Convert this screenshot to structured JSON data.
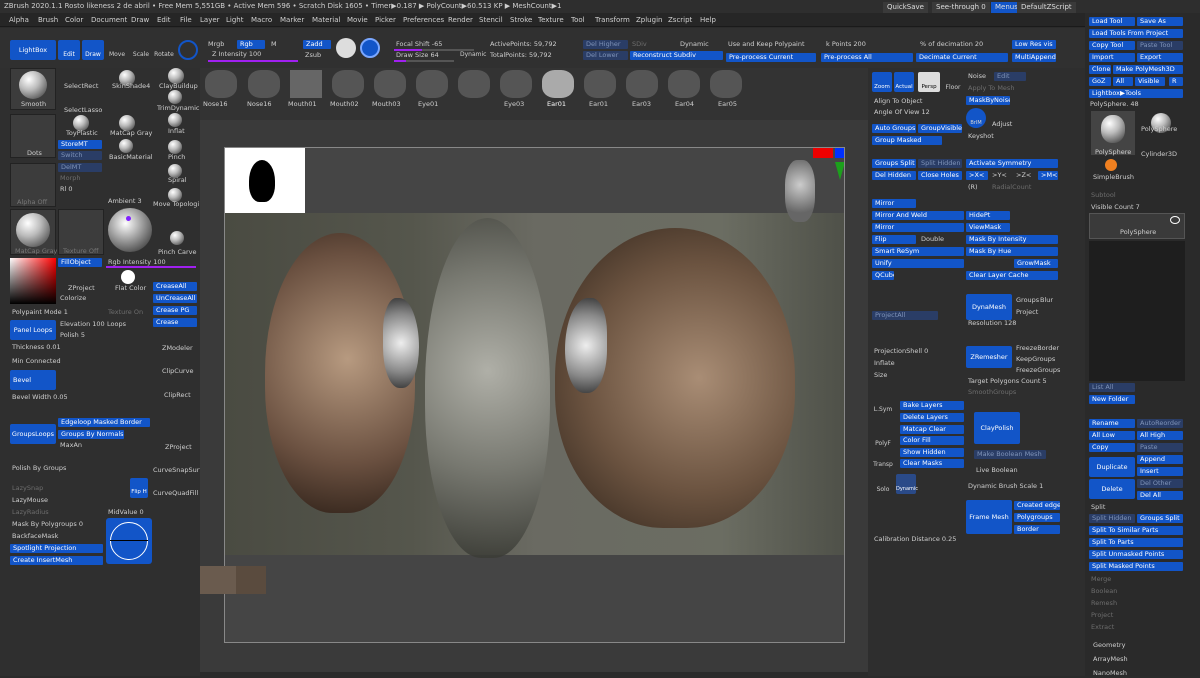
{
  "title_bar": {
    "text": "ZBrush 2020.1.1   Rosto likeness 2 de abril   • Free Mem 5,551GB • Active Mem 596 • Scratch Disk 1605 •  Timer▶0.187 ▶ PolyCount▶60.513 KP  ▶ MeshCount▶1"
  },
  "menus": [
    "Alpha",
    "Brush",
    "Color",
    "Document",
    "Draw",
    "Edit",
    "File",
    "Layer",
    "Light",
    "Macro",
    "Marker",
    "Material",
    "Movie",
    "Picker",
    "Preferences",
    "Render",
    "Stencil",
    "Stroke",
    "Texture",
    "Tool",
    "Transform",
    "Zplugin",
    "Zscript",
    "Help"
  ],
  "top_right": {
    "quicksave": "QuickSave",
    "seethrough": "See-through  0",
    "menus": "Menus",
    "script": "DefaultZScript"
  },
  "toolbar": {
    "lightbox": "LightBox",
    "edit": "Edit",
    "draw": "Draw",
    "move": "Move",
    "scale": "Scale",
    "rotate": "Rotate",
    "mrgb": "Mrgb",
    "rgb": "Rgb",
    "m": "M",
    "zadd": "Zadd",
    "zsub": "Zsub",
    "zintensity": "Z Intensity 100",
    "focal_shift": "Focal Shift -65",
    "draw_size": "Draw Size 64",
    "dynamic": "Dynamic",
    "active_points": "ActivePoints: 59,792",
    "total_points": "TotalPoints: 59,792",
    "del_higher": "Del Higher",
    "del_lower": "Del Lower",
    "sdiv": "SDiv",
    "reconstruct": "Reconstruct Subdiv",
    "dynamic2": "Dynamic",
    "keep_polypaint": "Use and Keep Polypaint",
    "preprocess_current": "Pre-process Current",
    "k_points": "k Points 200",
    "preprocess_all": "Pre-process All",
    "pct_decimation": "% of decimation 20",
    "decimate_current": "Decimate Current",
    "low_res_vis": "Low Res vis",
    "multi_append": "MultiAppend"
  },
  "left": {
    "smooth": "Smooth",
    "selectrect": "SelectRect",
    "selectlasso": "SelectLasso",
    "skinshade": "SkinShade4",
    "claybuildup": "ClayBuildup",
    "trimdynamic": "TrimDynamic",
    "dots": "Dots",
    "toyplastic": "ToyPlastic",
    "matcapgray": "MatCap Gray",
    "basicmaterial": "BasicMaterial",
    "storemt": "StoreMT",
    "switch": "Switch",
    "delmt": "DelMT",
    "morph": "Morph",
    "inflat": "Inflat",
    "pinch": "Pinch",
    "spiral": "Spiral",
    "movetopo": "Move Topologi",
    "alphaoff": "Alpha Off",
    "rl": "Rl 0",
    "ambient": "Ambient 3",
    "matcapgray2": "MatCap Gray",
    "textureoff": "Texture Off",
    "pinchcarve": "Pinch Carve",
    "fillobject": "FillObject",
    "rgb_intensity": "Rgb Intensity 100",
    "zproject": "ZProject",
    "flatcolor": "Flat Color",
    "colorize": "Colorize",
    "creaseall": "CreaseAll",
    "uncreaseall": "UnCreaseAll",
    "creasepg": "Crease PG",
    "crease": "Crease",
    "polypaint_mode": "Polypaint Mode 1",
    "texture_on": "Texture On",
    "panel_loops": "Panel Loops",
    "elevation": "Elevation 100",
    "loops": "Loops",
    "polish": "Polish 5",
    "thickness": "Thickness 0.01",
    "min_connected": "Min Connected",
    "zmodeler": "ZModeler",
    "clipcurve": "ClipCurve",
    "cliprect": "ClipRect",
    "bevel": "Bevel",
    "bevel_width": "Bevel Width 0.05",
    "edgeloop_masked": "Edgeloop Masked Border",
    "groupsloops": "GroupsLoops",
    "groups_by_normals": "Groups By Normals",
    "maxan": "MaxAn",
    "zproject2": "ZProject",
    "curvesnapsurface": "CurveSnapSurfa",
    "polish_by_groups": "Polish By Groups",
    "lazysnap": "LazySnap",
    "lazymouse": "LazyMouse",
    "lazyradius": "LazyRadius",
    "fliph": "Flip H",
    "curvequadfill": "CurveQuadFill",
    "midvalue": "MidValue 0",
    "mask_by_polygroups": "Mask By Polygroups 0",
    "backface_mask": "BackfaceMask",
    "spotlight_projection": "Spotlight Projection",
    "create_insertmesh": "Create InsertMesh"
  },
  "shelf": [
    "Nose16",
    "Nose16",
    "Mouth01",
    "Mouth02",
    "Mouth03",
    "Eye01",
    "Eye03",
    "Ear01",
    "Ear01",
    "Ear03",
    "Ear04",
    "Ear05"
  ],
  "rightmid": {
    "zoom": "Zoom",
    "actual": "Actual",
    "persp": "Persp",
    "floor": "Floor",
    "noise": "Noise",
    "edit": "Edit",
    "apply_to_mesh": "Apply To Mesh",
    "maskbynoise": "MaskByNoise",
    "align_to_object": "Align To Object",
    "angle_of_view": "Angle Of View 12",
    "brim": "BrIM",
    "adjust": "Adjust",
    "auto_groups": "Auto Groups",
    "group_visible": "GroupVisible",
    "keyshot": "Keyshot",
    "group_masked": "Group Masked",
    "groups_split": "Groups Split",
    "split_hidden": "Split Hidden",
    "del_hidden": "Del Hidden",
    "close_holes": "Close Holes",
    "activate_symmetry": "Activate Symmetry",
    ">x<": ">X<",
    ">y<": ">Y<",
    ">z<": ">Z<",
    ">m<": ">M<",
    "r": "(R)",
    "radialcount": "RadialCount",
    "mirror": "Mirror",
    "mirror_and_weld": "Mirror And Weld",
    "mirror2": "Mirror",
    "flip": "Flip",
    "double": "Double",
    "smart_resym": "Smart ReSym",
    "unify": "Unify",
    "qcube": "QCube",
    "hidept": "HidePt",
    "viewmask": "ViewMask",
    "mask_by_intensity": "Mask By Intensity",
    "mask_by_hue": "Mask By Hue",
    "growmask": "GrowMask",
    "clear_layer_cache": "Clear Layer Cache",
    "dynamesh": "DynaMesh",
    "groups": "Groups",
    "blur": "Blur",
    "project": "Project",
    "resolution": "Resolution 128",
    "projectall": "ProjectAll",
    "freezeborder": "FreezeBorder",
    "keepgroups": "KeepGroups",
    "freezegroups": "FreezeGroups",
    "zremesher": "ZRemesher",
    "target_polygons": "Target Polygons Count 5",
    "smoothgroups": "SmoothGroups",
    "projection_shell": "ProjectionShell 0",
    "inflate": "Inflate",
    "size": "Size",
    "lsym": "L.Sym",
    "polyf": "PolyF",
    "transp": "Transp",
    "solo": "Solo",
    "dynamic": "Dynamic",
    "bake_layers": "Bake Layers",
    "delete_layers": "Delete Layers",
    "matcap_clear": "Matcap Clear",
    "color_fill": "Color Fill",
    "show_hidden": "Show Hidden",
    "clear_masks": "Clear Masks",
    "claypolish": "ClayPolish",
    "make_boolean_mesh": "Make Boolean Mesh",
    "live_boolean": "Live Boolean",
    "dynamic_brush_scale": "Dynamic Brush Scale 1",
    "frame_mesh": "Frame Mesh",
    "created_edges": "Created edges",
    "polygroups": "Polygroups",
    "border": "Border",
    "calibration_distance": "Calibration Distance 0.25"
  },
  "right": {
    "load_tool": "Load Tool",
    "save_as": "Save As",
    "load_from_project": "Load Tools From Project",
    "copy_tool": "Copy Tool",
    "paste_tool": "Paste Tool",
    "import": "Import",
    "export": "Export",
    "clone": "Clone",
    "make_polymesh": "Make PolyMesh3D",
    "goz": "GoZ",
    "all": "All",
    "visible": "Visible",
    "r": "R",
    "lightbox_tools": "Lightbox▶Tools",
    "polysphere_48": "PolySphere. 48",
    "polysphere": "PolySphere",
    "polysphere2": "PolySphere",
    "cylinder3d": "Cylinder3D",
    "simplebrush": "SimpleBrush",
    "subtool": "Subtool",
    "visible_count": "Visible Count 7",
    "polysphere_item": "PolySphere",
    "list_all": "List All",
    "new_folder": "New Folder",
    "rename": "Rename",
    "autoreorder": "AutoReorder",
    "all_low": "All Low",
    "all_high": "All High",
    "copy": "Copy",
    "paste": "Paste",
    "duplicate": "Duplicate",
    "append": "Append",
    "insert": "Insert",
    "delete": "Delete",
    "del_other": "Del Other",
    "del_all": "Del All",
    "split": "Split",
    "split_hidden": "Split Hidden",
    "groups_split": "Groups Split",
    "split_similar": "Split To Similar Parts",
    "split_to_parts": "Split To Parts",
    "split_unmasked": "Split Unmasked Points",
    "split_masked": "Split Masked Points",
    "merge": "Merge",
    "boolean": "Boolean",
    "remesh": "Remesh",
    "project": "Project",
    "extract": "Extract",
    "geometry": "Geometry",
    "arraymesh": "ArrayMesh",
    "nanomesh": "NanoMesh"
  }
}
